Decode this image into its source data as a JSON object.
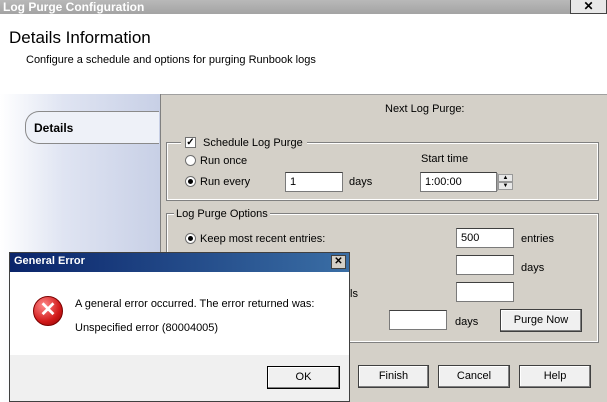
{
  "window": {
    "title": "Log Purge Configuration",
    "close_glyph": "✕"
  },
  "header": {
    "title": "Details Information",
    "subtitle": "Configure a schedule and options for purging Runbook logs"
  },
  "nav": {
    "items": [
      {
        "label": "Details",
        "selected": true
      }
    ]
  },
  "content": {
    "next_purge_label": "Next Log Purge:",
    "schedule": {
      "legend": "Schedule Log Purge",
      "checked": true,
      "run_once_label": "Run once",
      "run_every_label": "Run every",
      "run_every_value": "1",
      "days_label": "days",
      "start_time_label": "Start time",
      "start_time_value": "1:00:00"
    },
    "options": {
      "legend": "Log Purge Options",
      "keep_recent_label": "Keep most recent entries:",
      "keep_recent_value": "500",
      "entries_label": "entries",
      "days_label": "days",
      "partial_label": "ls",
      "purge_days_label": "days",
      "purge_now_label": "Purge Now"
    }
  },
  "footer": {
    "finish_label": "Finish",
    "cancel_label": "Cancel",
    "help_label": "Help"
  },
  "dialog": {
    "title": "General Error",
    "close_glyph": "✕",
    "message_line1": "A general error occurred.  The error returned was:",
    "message_line2": "Unspecified error (80004005)",
    "ok_label": "OK",
    "icon": "error-icon",
    "icon_glyph": "✕"
  }
}
